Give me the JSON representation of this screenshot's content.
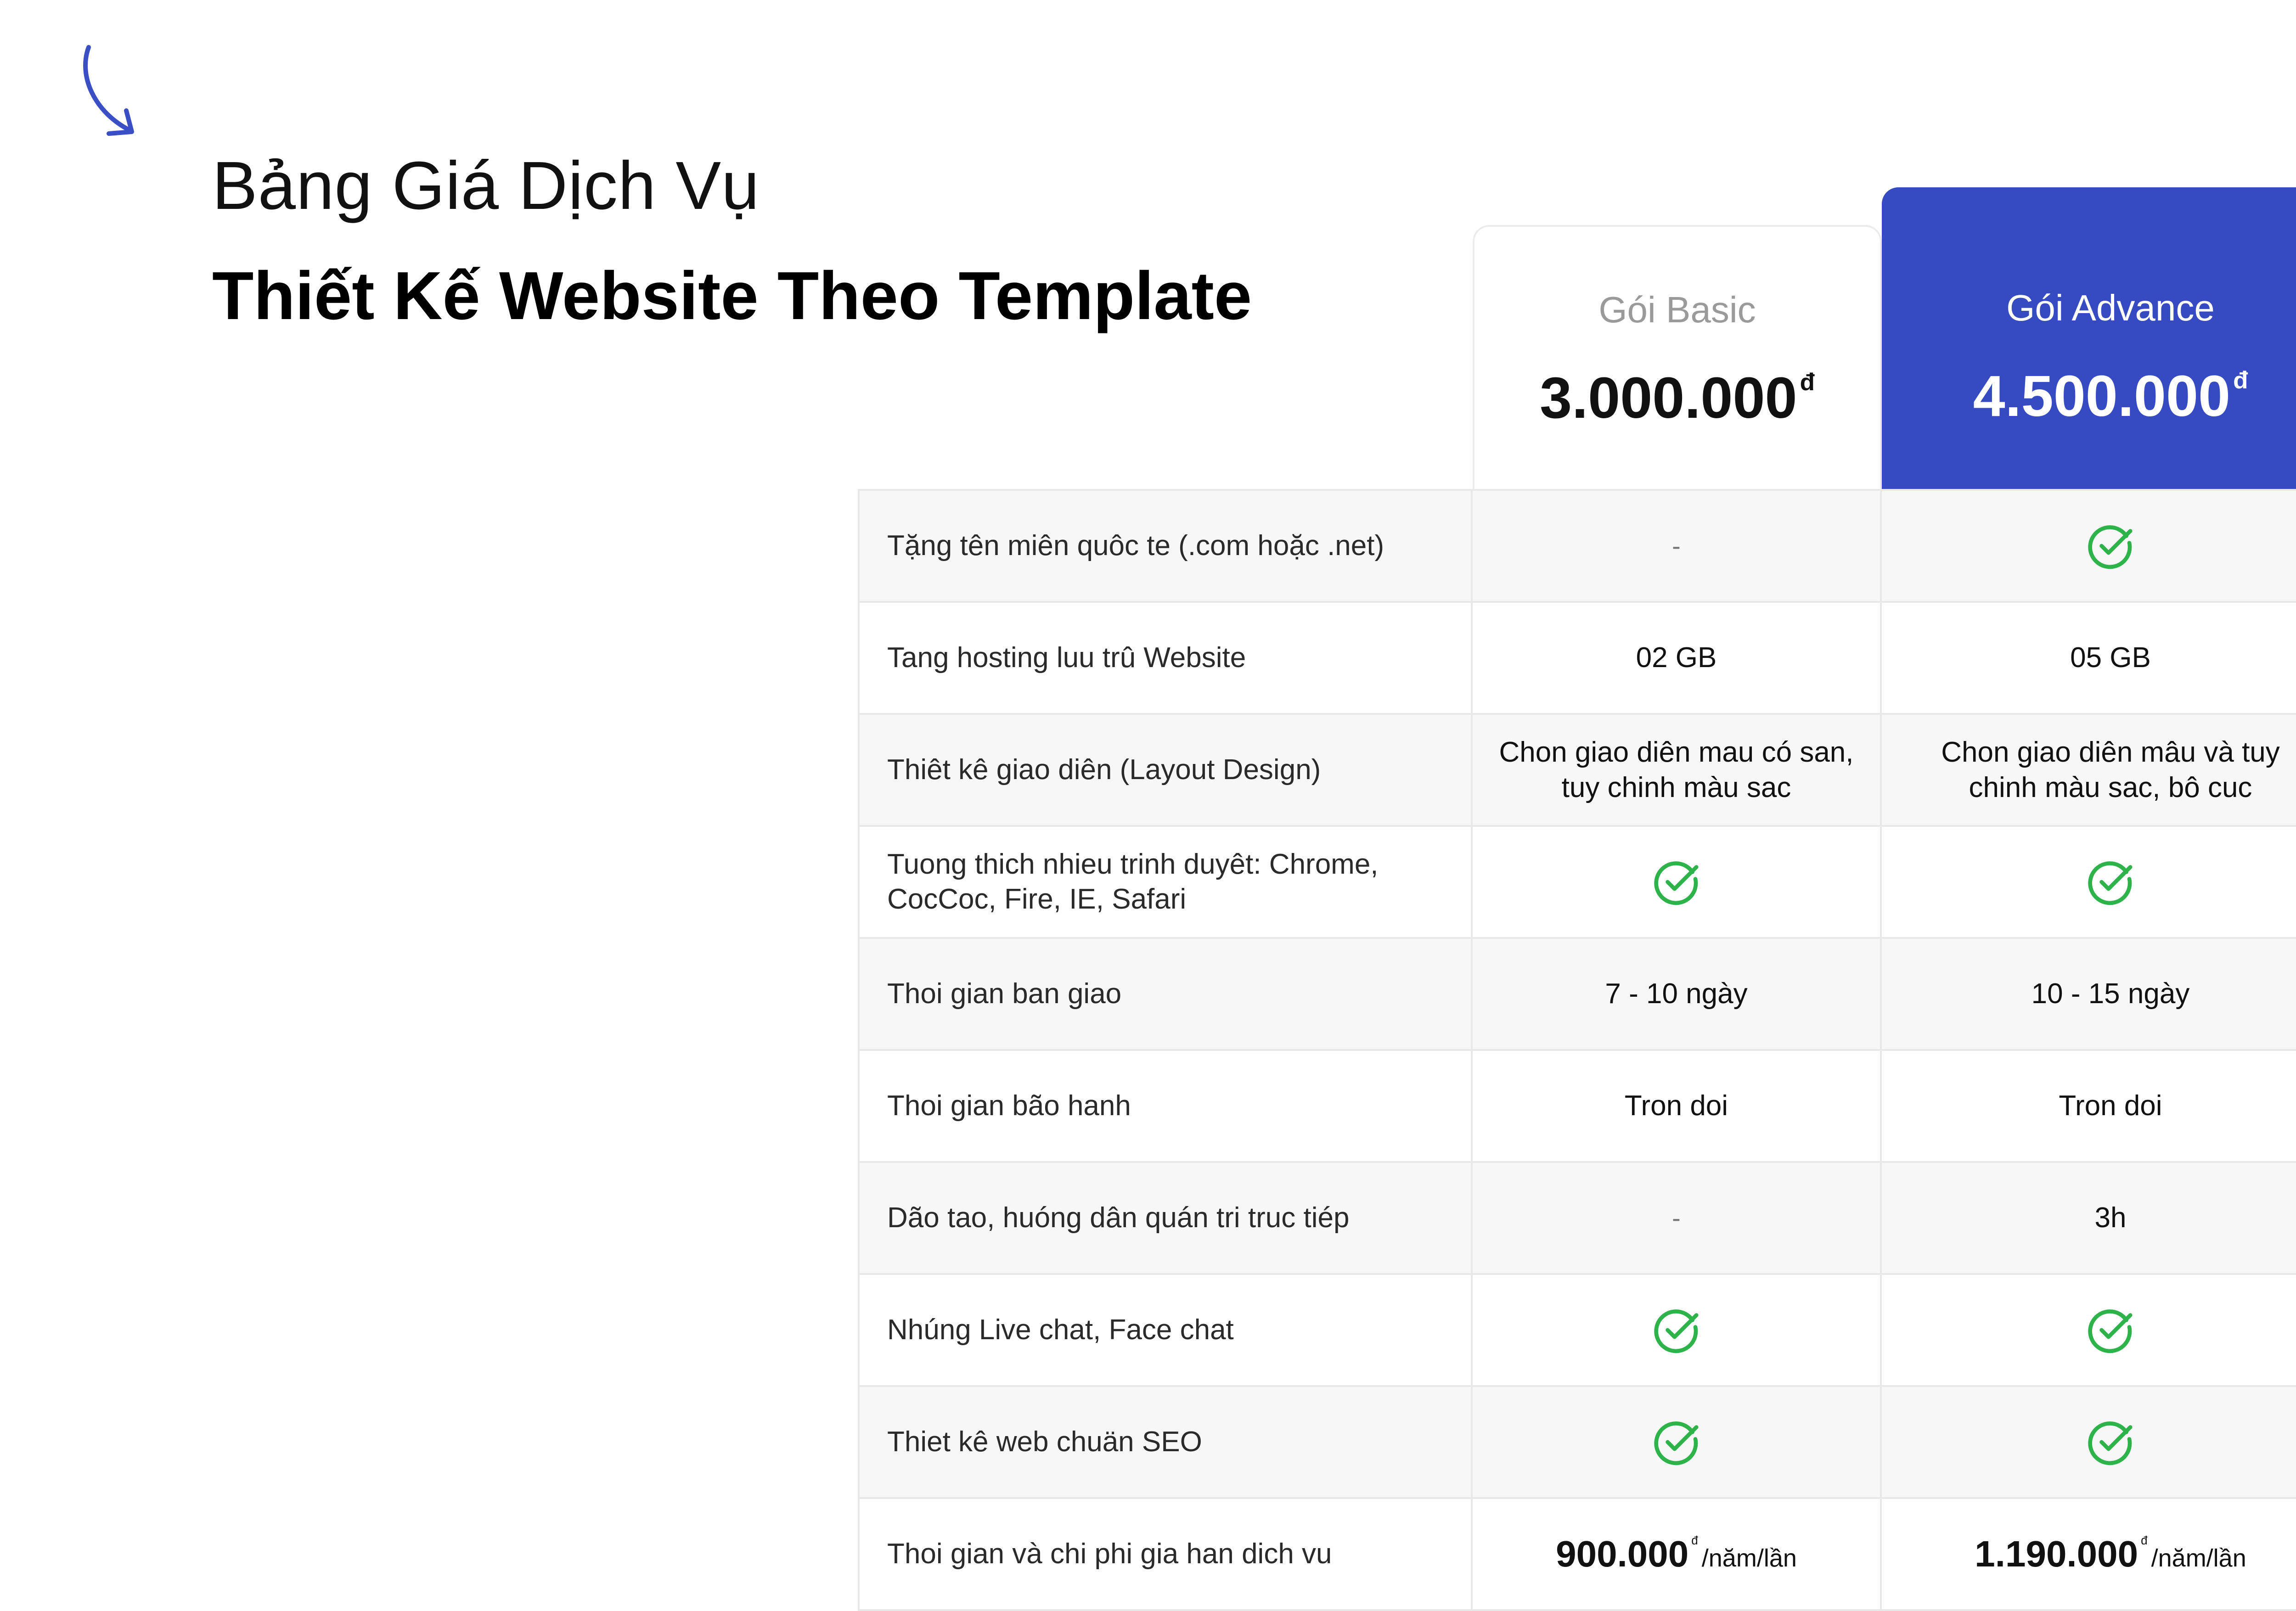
{
  "colors": {
    "accent": "#364bc2",
    "check": "#2eb34a",
    "text": "#111111"
  },
  "header": {
    "title_line1": "Bảng Giá Dịch Vụ",
    "title_line2": "Thiết Kế Website Theo Template"
  },
  "plans": {
    "basic": {
      "name": "Gói Basic",
      "price": "3.000.000",
      "currency": "đ"
    },
    "advance": {
      "name": "Gói Advance",
      "price": "4.500.000",
      "currency": "đ"
    }
  },
  "rows": [
    {
      "feature": "Tặng tên miên quôc te (.com hoặc .net)",
      "basic": "-",
      "advance": "check-icon"
    },
    {
      "feature": "Tang hosting luu trû Website",
      "basic": "02 GB",
      "advance": "05 GB"
    },
    {
      "feature": "Thiêt kê giao diên (Layout Design)",
      "basic": "Chon giao diên mau có san, tuy chinh màu sac",
      "advance": "Chon giao diên mâu và tuy chinh màu sac, bô cuc"
    },
    {
      "feature": "Tuong thich nhieu trinh duyêt: Chrome, CocCoc, Fire, IE, Safari",
      "basic": "check-icon",
      "advance": "check-icon"
    },
    {
      "feature": "Thoi gian ban giao",
      "basic": "7 - 10 ngày",
      "advance": "10 - 15 ngày"
    },
    {
      "feature": "Thoi gian bão hanh",
      "basic": "Tron doi",
      "advance": "Tron doi"
    },
    {
      "feature": "Dão tao, huóng dân quán tri truc tiép",
      "basic": "-",
      "advance": "3h"
    },
    {
      "feature": "Nhúng Live chat, Face chat",
      "basic": "check-icon",
      "advance": "check-icon"
    },
    {
      "feature": "Thiet kê web chuän SEO",
      "basic": "check-icon",
      "advance": "check-icon"
    },
    {
      "feature": "Thoi gian và chi phi gia han dich vu",
      "basic": "",
      "advance": ""
    }
  ],
  "renewal": {
    "basic": {
      "amount": "900.000",
      "currency": "đ",
      "unit": "/năm/lần"
    },
    "advance": {
      "amount": "1.190.000",
      "currency": "đ",
      "unit": "/năm/lần"
    }
  }
}
